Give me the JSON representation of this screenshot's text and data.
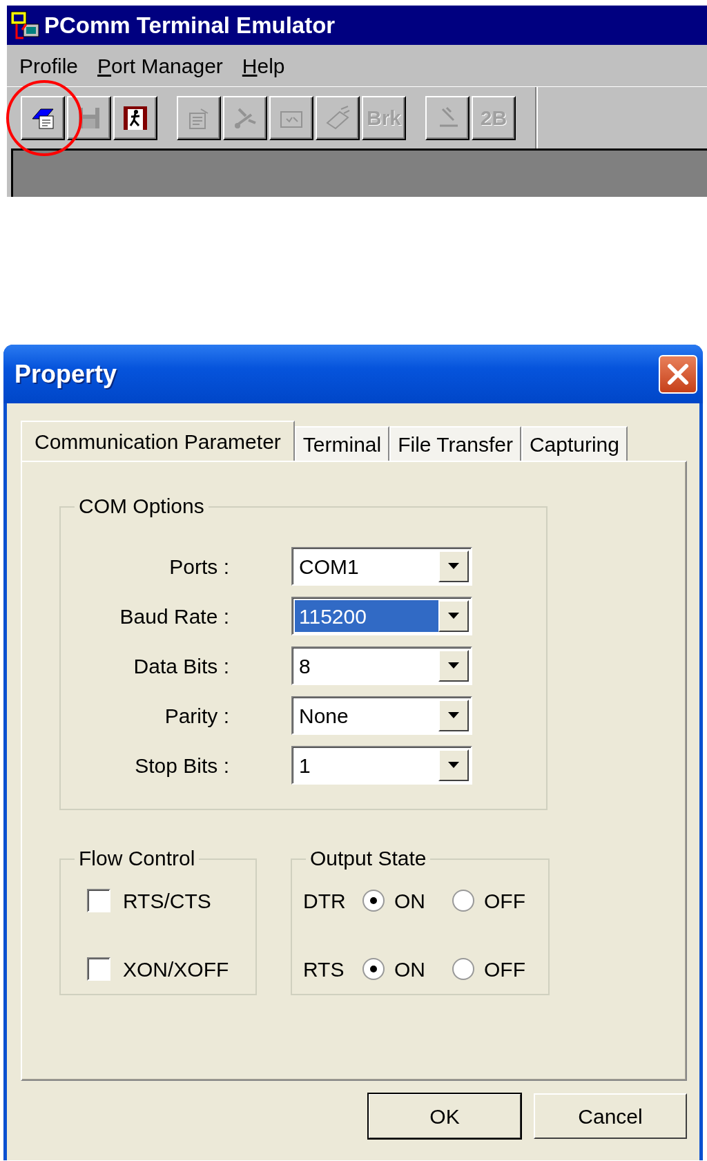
{
  "app_window": {
    "title": "PComm Terminal Emulator",
    "menu": [
      {
        "label": "Profile",
        "key_underlined": false
      },
      {
        "label": "Port Manager",
        "key_underlined": true
      },
      {
        "label": "Help",
        "key_underlined": true
      }
    ],
    "toolbar_groups": [
      {
        "buttons": [
          {
            "kind": "icon",
            "disabled": false,
            "highlighted": true
          },
          {
            "kind": "icon",
            "disabled": true,
            "highlighted": false
          },
          {
            "kind": "icon",
            "disabled": false,
            "highlighted": false
          }
        ]
      },
      {
        "buttons": [
          {
            "kind": "icon",
            "disabled": true,
            "highlighted": false
          },
          {
            "kind": "icon",
            "disabled": true,
            "highlighted": false
          },
          {
            "kind": "icon",
            "disabled": true,
            "highlighted": false
          },
          {
            "kind": "icon",
            "disabled": true,
            "highlighted": false
          },
          {
            "kind": "text",
            "label": "Brk",
            "disabled": true,
            "highlighted": false
          }
        ]
      },
      {
        "buttons": [
          {
            "kind": "icon",
            "disabled": true,
            "highlighted": false
          },
          {
            "kind": "text",
            "label": "2B",
            "disabled": true,
            "highlighted": false
          }
        ]
      }
    ]
  },
  "dialog": {
    "title": "Property",
    "tabs": [
      {
        "label": "Communication Parameter",
        "selected": true
      },
      {
        "label": "Terminal",
        "selected": false
      },
      {
        "label": "File Transfer",
        "selected": false
      },
      {
        "label": "Capturing",
        "selected": false
      }
    ],
    "com_options": {
      "title": "COM Options",
      "fields": [
        {
          "label": "Ports :",
          "value": "COM1",
          "focused": false
        },
        {
          "label": "Baud Rate :",
          "value": "115200",
          "focused": true
        },
        {
          "label": "Data Bits :",
          "value": "8",
          "focused": false
        },
        {
          "label": "Parity :",
          "value": "None",
          "focused": false
        },
        {
          "label": "Stop Bits :",
          "value": "1",
          "focused": false
        }
      ]
    },
    "flow_control": {
      "title": "Flow Control",
      "options": [
        {
          "label": "RTS/CTS",
          "checked": false
        },
        {
          "label": "XON/XOFF",
          "checked": false
        }
      ]
    },
    "output_state": {
      "title": "Output State",
      "lines": [
        {
          "label": "DTR",
          "options": [
            {
              "label": "ON",
              "selected": true
            },
            {
              "label": "OFF",
              "selected": false
            }
          ]
        },
        {
          "label": "RTS",
          "options": [
            {
              "label": "ON",
              "selected": true
            },
            {
              "label": "OFF",
              "selected": false
            }
          ]
        }
      ]
    },
    "buttons": [
      {
        "label": "OK",
        "default": true
      },
      {
        "label": "Cancel",
        "default": false
      }
    ]
  }
}
